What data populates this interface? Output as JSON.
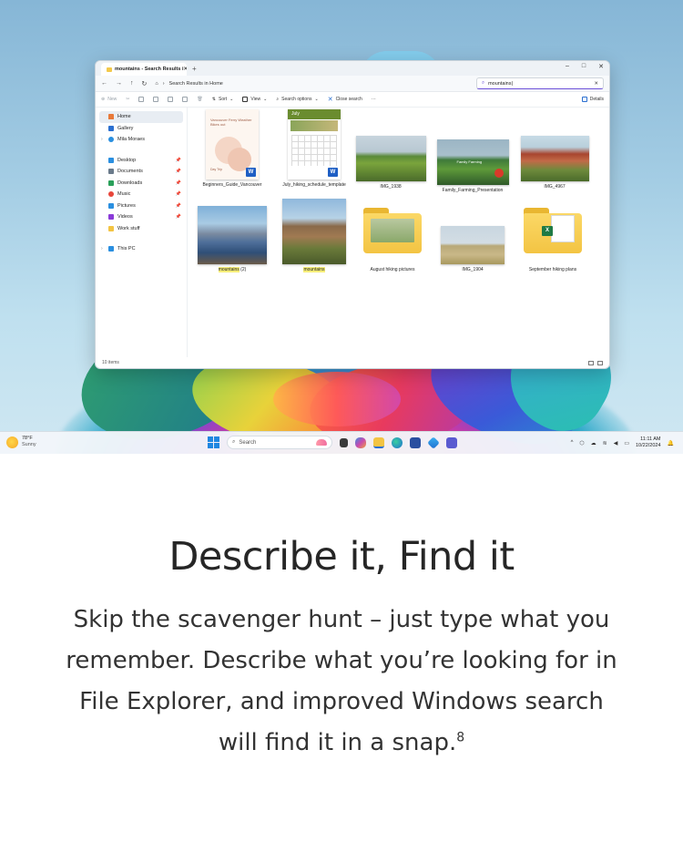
{
  "window": {
    "tab_title": "mountains - Search Results i",
    "tab_close": "✕",
    "new_tab": "+",
    "controls": {
      "minimize": "–",
      "maximize": "□",
      "close": "✕"
    },
    "nav_back": "←",
    "nav_forward": "→",
    "nav_up": "↑",
    "refresh": "↻",
    "breadcrumb": "Search Results in Home",
    "search_value": "mountains|",
    "search_clear": "✕"
  },
  "commandbar": {
    "new": "New",
    "sort": "Sort",
    "view": "View",
    "search_options": "Search options",
    "close_search": "Close search",
    "more": "···",
    "details": "Details"
  },
  "sidebar": {
    "items": [
      {
        "label": "Home",
        "color": "#e8793a"
      },
      {
        "label": "Gallery",
        "color": "#2a6fd0"
      },
      {
        "label": "Mila Moraes",
        "color": "#2a8fe0"
      }
    ],
    "pinned": [
      {
        "label": "Desktop",
        "color": "#2a8fe0"
      },
      {
        "label": "Documents",
        "color": "#6a7a8a"
      },
      {
        "label": "Downloads",
        "color": "#2aa05a"
      },
      {
        "label": "Music",
        "color": "#e8453a"
      },
      {
        "label": "Pictures",
        "color": "#2a8fe0"
      },
      {
        "label": "Videos",
        "color": "#8a3ad8"
      },
      {
        "label": "Work stuff",
        "color": "#f3c443"
      }
    ],
    "this_pc": "This PC"
  },
  "files": [
    {
      "name": "Beginners_Guide_Vancouver",
      "doc_text": "Vancouver Ferry Weather Bikes out",
      "doc_sub": "Day Trip",
      "badge": "W"
    },
    {
      "name": "July_hiking_schedule_template",
      "doc_header": "July",
      "badge": "W"
    },
    {
      "name": "IMG_1938"
    },
    {
      "name": "Family_Farming_Presentation",
      "caption": "Family Farming"
    },
    {
      "name": "IMG_4967"
    },
    {
      "name_hl": "mountains",
      "name_rest": " (2)"
    },
    {
      "name_hl": "mountains"
    },
    {
      "name": "August hiking pictures"
    },
    {
      "name": "IMG_1904"
    },
    {
      "name": "September hiking plans",
      "badge": "X"
    }
  ],
  "status": {
    "count": "10 items"
  },
  "taskbar": {
    "weather_temp": "78°F",
    "weather_desc": "Sunny",
    "search_label": "Search",
    "time": "11:11 AM",
    "date": "10/22/2024"
  },
  "marketing": {
    "headline": "Describe it, Find it",
    "body": "Skip the scavenger hunt – just type what you remember. Describe what you’re looking for in File Explorer, and improved Windows search will find it in a snap.",
    "footnote": "8"
  }
}
